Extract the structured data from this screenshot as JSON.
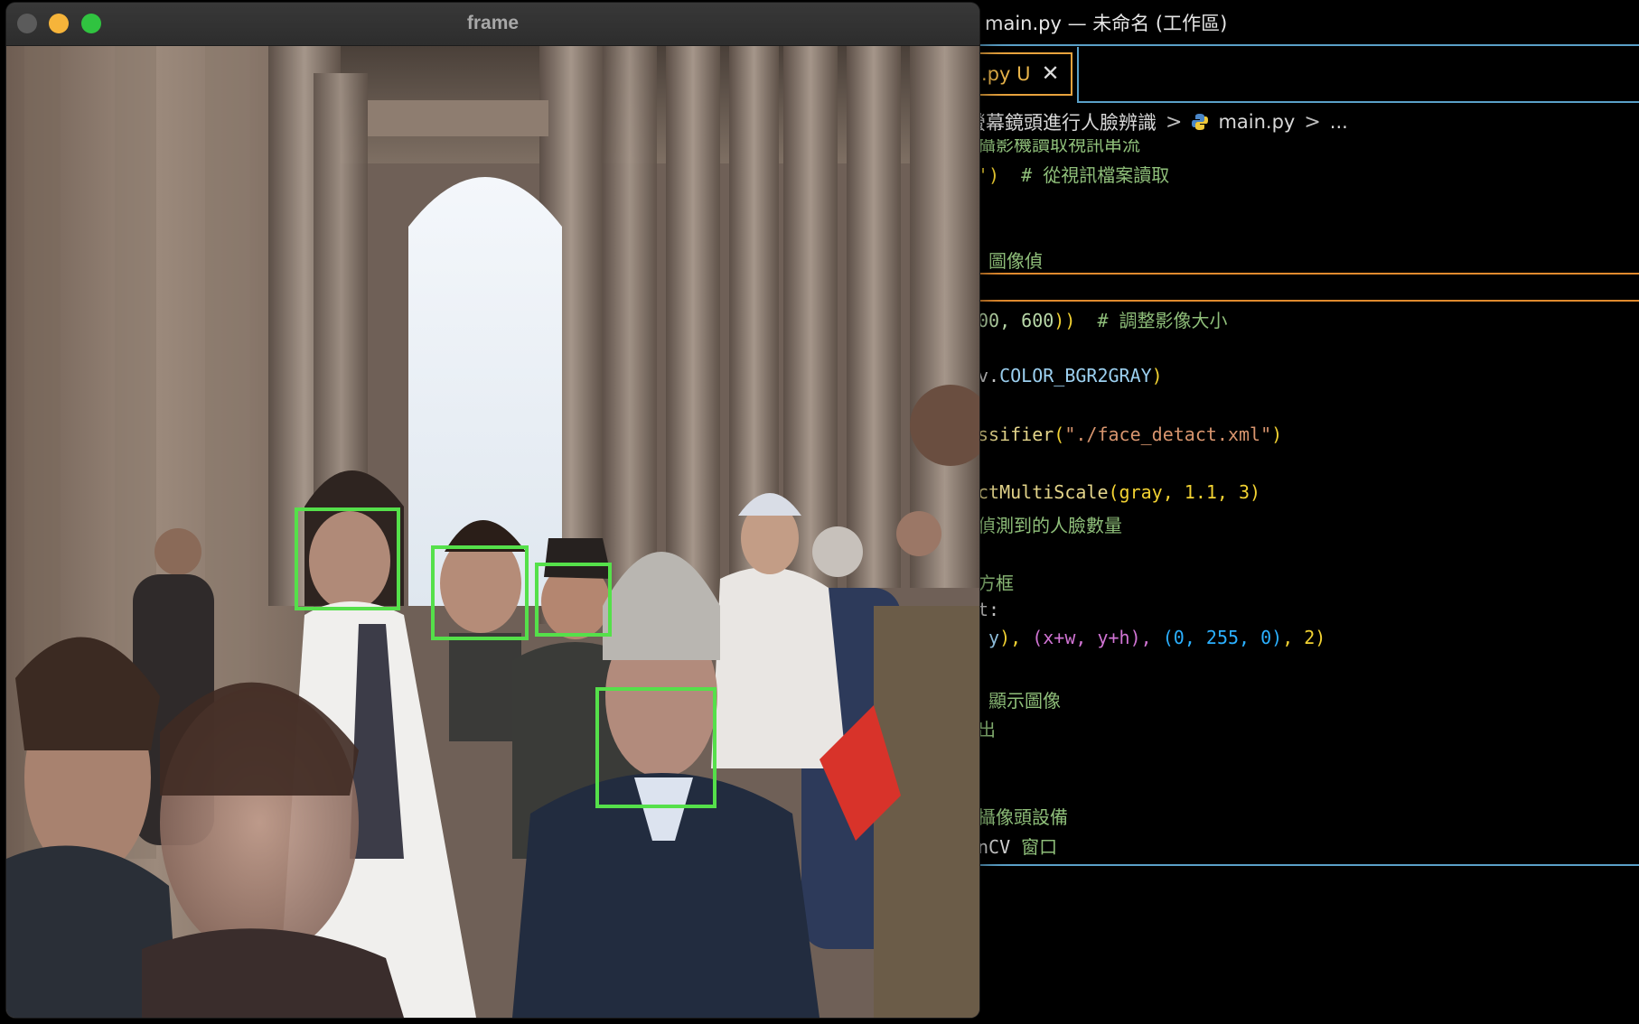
{
  "editor": {
    "title": "main.py — 未命名 (工作區)",
    "tab": {
      "label": ".py U",
      "close_glyph": "✕"
    },
    "breadcrumb": {
      "folder": "螢幕鏡頭進行人臉辨識",
      "separator": ">",
      "file": "main.py",
      "more": "..."
    },
    "icons": [
      "python-icon",
      "close-icon",
      "chevron-right-icon"
    ],
    "colors": {
      "tab_border": "#e8a33d",
      "divider": "#5aa0c8",
      "current_line": "#e08a2e",
      "comment": "#8fbf7a"
    }
  },
  "code": {
    "l1": "攝影機讀取視訊串流",
    "l2_a": "')",
    "l2_b": "  # 從視訊檔案讀取",
    "l3": " 圖像偵",
    "l4_a": "00, 600",
    "l4_b": "))",
    "l4_c": "  # 調整影像大小",
    "l5_a": "v.",
    "l5_b": "COLOR_BGR2GRAY",
    "l5_c": ")",
    "l6_a": "ssifier",
    "l6_b": "(",
    "l6_c": "\"./face_detact.xml\"",
    "l6_d": ")",
    "l7_a": "ctMultiScale",
    "l7_b": "(gray, 1.1, 3)",
    "l8": "偵測到的人臉數量",
    "l9": "方框",
    "l10": "t:",
    "l11_a": " y",
    "l11_b": "),",
    "l11_c": " (x+w, y+h), ",
    "l11_d": "(0, 255, 0)",
    "l11_e": ", 2)",
    "l12": " 顯示圖像",
    "l13": "出",
    "l14": "攝像頭設備",
    "l15_a": "nCV",
    "l15_b": " 窗口"
  },
  "frame_window": {
    "title": "frame",
    "traffic_lights": [
      "close-button",
      "minimize-button",
      "maximize-button"
    ],
    "box_color": "#55e04a",
    "faces_detected": 4
  }
}
